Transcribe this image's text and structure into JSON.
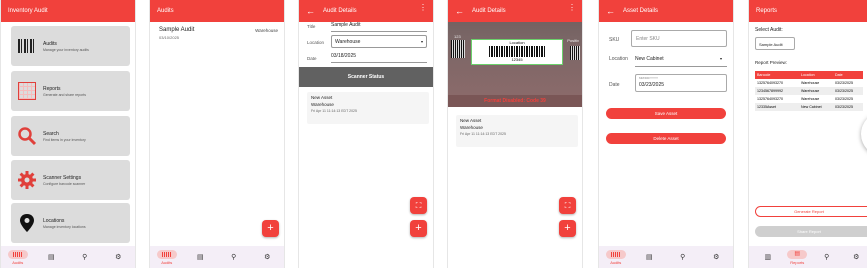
{
  "colors": {
    "accent": "#f1413c",
    "nav_bg": "#f4eef7",
    "card_bg": "#dcdcdc"
  },
  "nav": {
    "audits": "Audits",
    "reports": "Reports"
  },
  "s1": {
    "title": "Inventory Audit",
    "cards": [
      {
        "title": "Audits",
        "subtitle": "Manage your inventory audits",
        "icon": "barcode-icon"
      },
      {
        "title": "Reports",
        "subtitle": "Generate and share reports",
        "icon": "spreadsheet-icon"
      },
      {
        "title": "Search",
        "subtitle": "Find items in your inventory",
        "icon": "search-icon"
      },
      {
        "title": "Scanner Settings",
        "subtitle": "Configure barcode scanner",
        "icon": "gear-icon"
      },
      {
        "title": "Locations",
        "subtitle": "Manage inventory locations",
        "icon": "location-pin-icon"
      }
    ]
  },
  "s2": {
    "title": "Audits",
    "audit_name": "Sample Audit",
    "audit_date": "03/10/2025",
    "audit_location": "Warehouse",
    "fab": "+"
  },
  "s3": {
    "title": "Audit Details",
    "title_label": "Title",
    "title_value": "Sample Audit",
    "location_label": "Location",
    "location_value": "Warehouse",
    "date_label": "Date",
    "date_value": "03/18/2025",
    "status_title": "Scanner Status",
    "item_name": "New Asset",
    "item_location": "Warehouse",
    "item_time": "Fri Apr 11 11:14:13 EDT 2025",
    "fab": "+"
  },
  "s4": {
    "title": "Audit Details",
    "scan_left": "123",
    "scan_center_label": "Location",
    "scan_center_value": "12345",
    "scan_right": "Positiv",
    "status_text": "Format Disabled: Code 39",
    "item_name": "New Asset",
    "item_location": "Warehouse",
    "item_time": "Fri Apr 11 11:14:13 EDT 2025",
    "fab": "+"
  },
  "s5": {
    "title": "Asset Details",
    "sku_label": "SKU",
    "sku_placeholder": "Enter SKU",
    "location_label": "Location",
    "location_value": "New Cabinet",
    "date_label": "Date",
    "date_hint": "MM/DD/YYYY",
    "date_value": "03/23/2025",
    "save": "Save Asset",
    "delete": "Delete Asset"
  },
  "s6": {
    "title": "Reports",
    "select_label": "Select Audit:",
    "select_value": "Sample Audit",
    "preview_label": "Report Preview:",
    "headers": [
      "Barcode",
      "Location",
      "Date"
    ],
    "rows": [
      [
        "1325764093270",
        "Warehouse",
        "03/23/2025"
      ],
      [
        "1234567899992",
        "Warehouse",
        "03/23/2025"
      ],
      [
        "1325764093270",
        "Warehouse",
        "03/23/2025"
      ],
      [
        "12335Asset",
        "New Cabinet",
        "03/23/2025"
      ]
    ],
    "generate": "Generate Report",
    "share": "Share Report"
  }
}
